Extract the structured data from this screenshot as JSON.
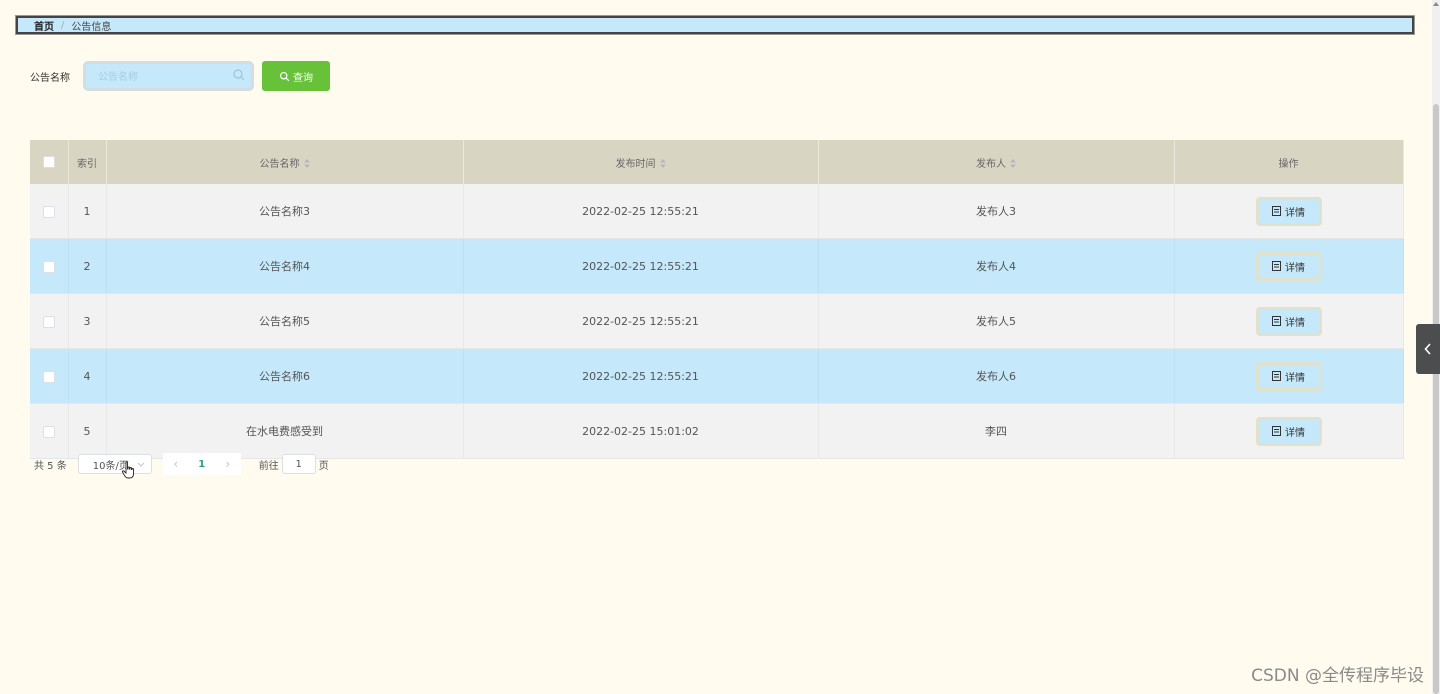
{
  "breadcrumb": {
    "home": "首页",
    "separator": "/",
    "current": "公告信息"
  },
  "search": {
    "label": "公告名称",
    "placeholder": "公告名称",
    "value": "",
    "button_label": "查询"
  },
  "table": {
    "columns": [
      "索引",
      "公告名称",
      "发布时间",
      "发布人",
      "操作"
    ],
    "rows": [
      {
        "index": "1",
        "name": "公告名称3",
        "time": "2022-02-25 12:55:21",
        "publisher": "发布人3",
        "action": "详情"
      },
      {
        "index": "2",
        "name": "公告名称4",
        "time": "2022-02-25 12:55:21",
        "publisher": "发布人4",
        "action": "详情"
      },
      {
        "index": "3",
        "name": "公告名称5",
        "time": "2022-02-25 12:55:21",
        "publisher": "发布人5",
        "action": "详情"
      },
      {
        "index": "4",
        "name": "公告名称6",
        "time": "2022-02-25 12:55:21",
        "publisher": "发布人6",
        "action": "详情"
      },
      {
        "index": "5",
        "name": "在水电费感受到",
        "time": "2022-02-25 15:01:02",
        "publisher": "李四",
        "action": "详情"
      }
    ]
  },
  "pagination": {
    "total": "共 5 条",
    "page_size": "10条/页",
    "current_page": "1",
    "goto_prefix": "前往",
    "goto_value": "1",
    "goto_suffix": "页"
  },
  "watermark": "CSDN @全传程序毕设",
  "colors": {
    "background": "#fffbef",
    "accent_blue": "#c5e8fa",
    "header": "#d8d6c3",
    "query_button": "#67c23a",
    "active_page": "#28a08c"
  }
}
